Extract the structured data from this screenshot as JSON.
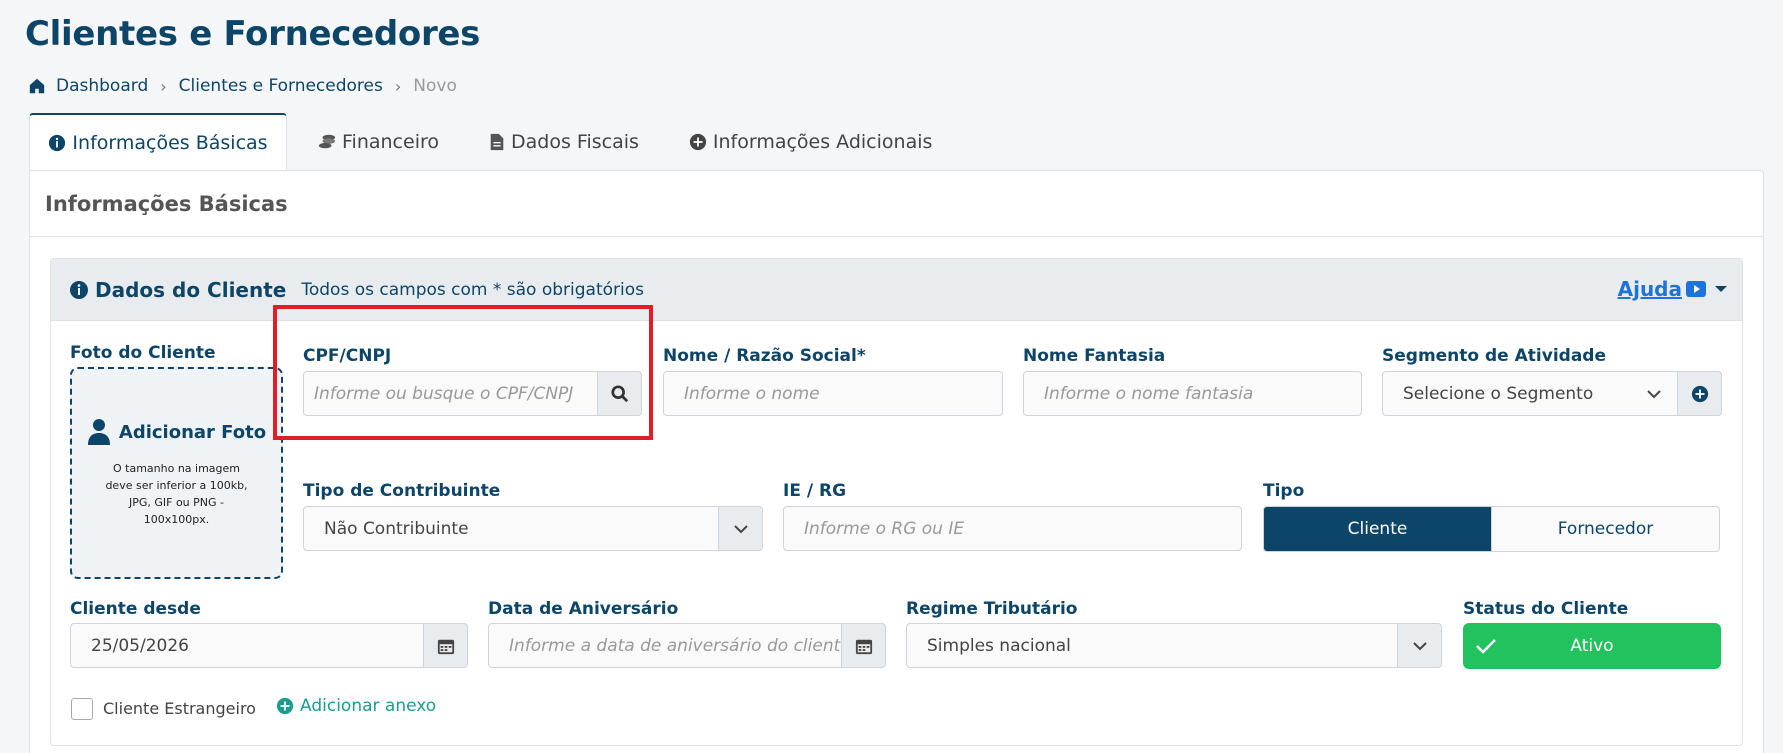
{
  "page": {
    "title": "Clientes e Fornecedores"
  },
  "breadcrumb": {
    "items": [
      "Dashboard",
      "Clientes e Fornecedores",
      "Novo"
    ]
  },
  "tabs": [
    {
      "label": "Informações Básicas",
      "icon": "info-icon",
      "active": true
    },
    {
      "label": "Financeiro",
      "icon": "coins-icon"
    },
    {
      "label": "Dados Fiscais",
      "icon": "file-icon"
    },
    {
      "label": "Informações Adicionais",
      "icon": "plus-circle-icon"
    }
  ],
  "card": {
    "title": "Informações Básicas"
  },
  "panel": {
    "title": "Dados do Cliente",
    "subtitle": "Todos os campos com * são obrigatórios",
    "help_label": "Ajuda"
  },
  "photo": {
    "label": "Foto do Cliente",
    "add_label": "Adicionar Foto",
    "hint": "O tamanho na imagem deve ser inferior a 100kb, JPG, GIF ou PNG - 100x100px."
  },
  "fields": {
    "cpf": {
      "label": "CPF/CNPJ",
      "placeholder": "Informe ou busque o CPF/CNPJ"
    },
    "nome": {
      "label": "Nome / Razão Social*",
      "placeholder": "Informe o nome"
    },
    "fantasia": {
      "label": "Nome Fantasia",
      "placeholder": "Informe o nome fantasia"
    },
    "segmento": {
      "label": "Segmento de Atividade",
      "value": "Selecione o Segmento"
    },
    "contribuinte": {
      "label": "Tipo de Contribuinte",
      "value": "Não Contribuinte"
    },
    "ie": {
      "label": "IE / RG",
      "placeholder": "Informe o RG ou IE"
    },
    "tipo": {
      "label": "Tipo",
      "options": [
        "Cliente",
        "Fornecedor"
      ],
      "selected": "Cliente"
    },
    "desde": {
      "label": "Cliente desde",
      "value": "25/05/2026"
    },
    "aniversario": {
      "label": "Data de Aniversário",
      "placeholder": "Informe a data de aniversário do cliente"
    },
    "regime": {
      "label": "Regime Tributário",
      "value": "Simples nacional"
    },
    "status": {
      "label": "Status do Cliente",
      "value": "Ativo"
    }
  },
  "footer": {
    "foreign_label": "Cliente Estrangeiro",
    "attach_label": "Adicionar anexo"
  },
  "colors": {
    "primary": "#0d4569",
    "success": "#22c35e",
    "highlight": "#e01e26",
    "link": "#1e73d8",
    "teal": "#1c9c8c"
  }
}
